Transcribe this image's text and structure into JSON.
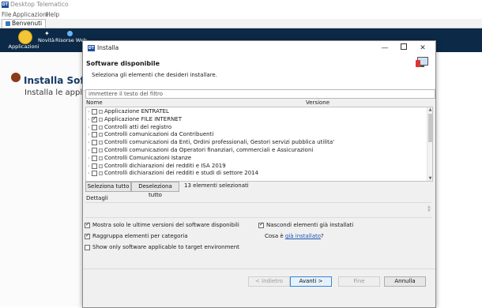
{
  "app": {
    "logo_text": "DT",
    "title": "Desktop Telematico",
    "menu": [
      "File",
      "Applicazioni",
      "Help"
    ],
    "tab_label": "Benvenuti"
  },
  "navbar": {
    "apps_label": "Applicazioni",
    "news_label": "Novità",
    "web_label": "Risorse Web"
  },
  "background": {
    "heading": "Installa Soft",
    "subtext": "Installa le applic"
  },
  "dialog": {
    "title": "Installa",
    "heading": "Software disponibile",
    "description": "Seleziona gli elementi che desideri installare.",
    "filter_placeholder": "immettere il testo del filtro",
    "columns": {
      "name": "Nome",
      "version": "Versione"
    },
    "items": [
      {
        "label": "Applicazione ENTRATEL",
        "checked": false
      },
      {
        "label": "Applicazione FILE INTERNET",
        "checked": true
      },
      {
        "label": "Controlli atti del registro",
        "checked": false
      },
      {
        "label": "Controlli comunicazioni da Contribuenti",
        "checked": false
      },
      {
        "label": "Controlli comunicazioni da Enti, Ordini professionali, Gestori servizi pubblica utilita'",
        "checked": false
      },
      {
        "label": "Controlli comunicazioni da Operatori finanziari, commerciali e Assicurazioni",
        "checked": false
      },
      {
        "label": "Controlli Comunicazioni Istanze",
        "checked": false
      },
      {
        "label": "Controlli dichiarazioni dei redditi e ISA 2019",
        "checked": false
      },
      {
        "label": "Controlli dichiarazioni dei redditi e studi di settore 2014",
        "checked": false
      }
    ],
    "select_all": "Seleziona tutto",
    "deselect_all": "Deseleziona tutto",
    "selected_count": "13 elementi selezionati",
    "details_label": "Dettagli",
    "options": {
      "latest_only": {
        "label": "Mostra solo le ultime versioni del software disponibili",
        "checked": true
      },
      "group_by_category": {
        "label": "Raggruppa elementi per categoria",
        "checked": true
      },
      "target_env": {
        "label": "Show only software applicable to target environment",
        "checked": false
      },
      "hide_installed": {
        "label": "Nascondi elementi già installati",
        "checked": true
      }
    },
    "whats_installed_prefix": "Cosa è ",
    "whats_installed_link": "già installato",
    "whats_installed_suffix": "?",
    "buttons": {
      "back": "< Indietro",
      "next": "Avanti >",
      "finish": "Fine",
      "cancel": "Annulla"
    }
  }
}
